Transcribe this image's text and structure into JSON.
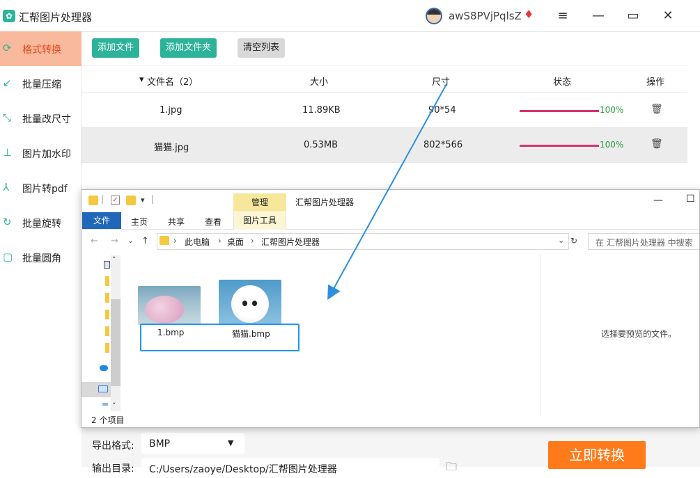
{
  "app": {
    "title": "汇帮图片处理器",
    "username": "awS8PVjPqlsZ"
  },
  "sidebar": {
    "items": [
      {
        "label": "格式转换",
        "icon": "convert-icon"
      },
      {
        "label": "批量压缩",
        "icon": "compress-icon"
      },
      {
        "label": "批量改尺寸",
        "icon": "resize-icon"
      },
      {
        "label": "图片加水印",
        "icon": "watermark-icon"
      },
      {
        "label": "图片转pdf",
        "icon": "pdf-icon"
      },
      {
        "label": "批量旋转",
        "icon": "rotate-icon"
      },
      {
        "label": "批量圆角",
        "icon": "round-corner-icon"
      }
    ]
  },
  "toolbar": {
    "add_file": "添加文件",
    "add_folder": "添加文件夹",
    "clear_list": "清空列表"
  },
  "table": {
    "headers": {
      "name": "文件名（2）",
      "size": "大小",
      "dimension": "尺寸",
      "status": "状态",
      "action": "操作"
    },
    "rows": [
      {
        "name": "1.jpg",
        "size": "11.89KB",
        "dimension": "90*54",
        "progress_pct": 100,
        "progress_label": "100%"
      },
      {
        "name": "猫猫.jpg",
        "size": "0.53MB",
        "dimension": "802*566",
        "progress_pct": 100,
        "progress_label": "100%"
      }
    ]
  },
  "explorer": {
    "manage_tab": "管理",
    "title": "汇帮图片处理器",
    "tabs": {
      "file": "文件",
      "home": "主页",
      "share": "共享",
      "view": "查看",
      "pictools": "图片工具"
    },
    "breadcrumb": [
      "此电脑",
      "桌面",
      "汇帮图片处理器"
    ],
    "search_placeholder": "在 汇帮图片处理器 中搜索",
    "files": [
      "1.bmp",
      "猫猫.bmp"
    ],
    "preview_text": "选择要预览的文件。",
    "status": "2 个项目"
  },
  "bottom": {
    "export_label": "导出格式:",
    "export_value": "BMP",
    "output_label": "输出目录:",
    "output_path": "C:/Users/zaoye/Desktop/汇帮图片处理器",
    "convert_button": "立即转换"
  },
  "colors": {
    "accent": "#2db39a",
    "active_bg": "#f8b99c",
    "convert": "#ff7a1a",
    "progress": "#d6336c"
  }
}
